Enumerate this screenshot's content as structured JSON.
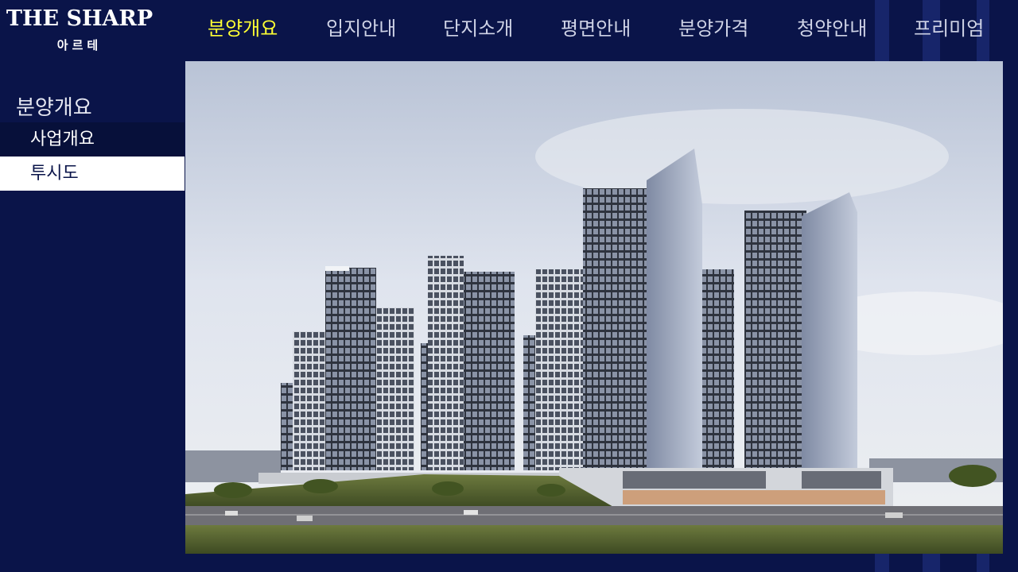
{
  "logo": {
    "main": "THE SHARP",
    "sub": "아르테"
  },
  "nav": {
    "items": [
      "분양개요",
      "입지안내",
      "단지소개",
      "평면안내",
      "분양가격",
      "청약안내",
      "프리미엄"
    ],
    "active_index": 0
  },
  "sidebar": {
    "title": "분양개요",
    "items": [
      "사업개요",
      "투시도"
    ],
    "active_index": 1
  },
  "colors": {
    "background": "#0a1449",
    "active_nav": "#ffff33",
    "sidebar_active_bg": "#ffffff"
  }
}
